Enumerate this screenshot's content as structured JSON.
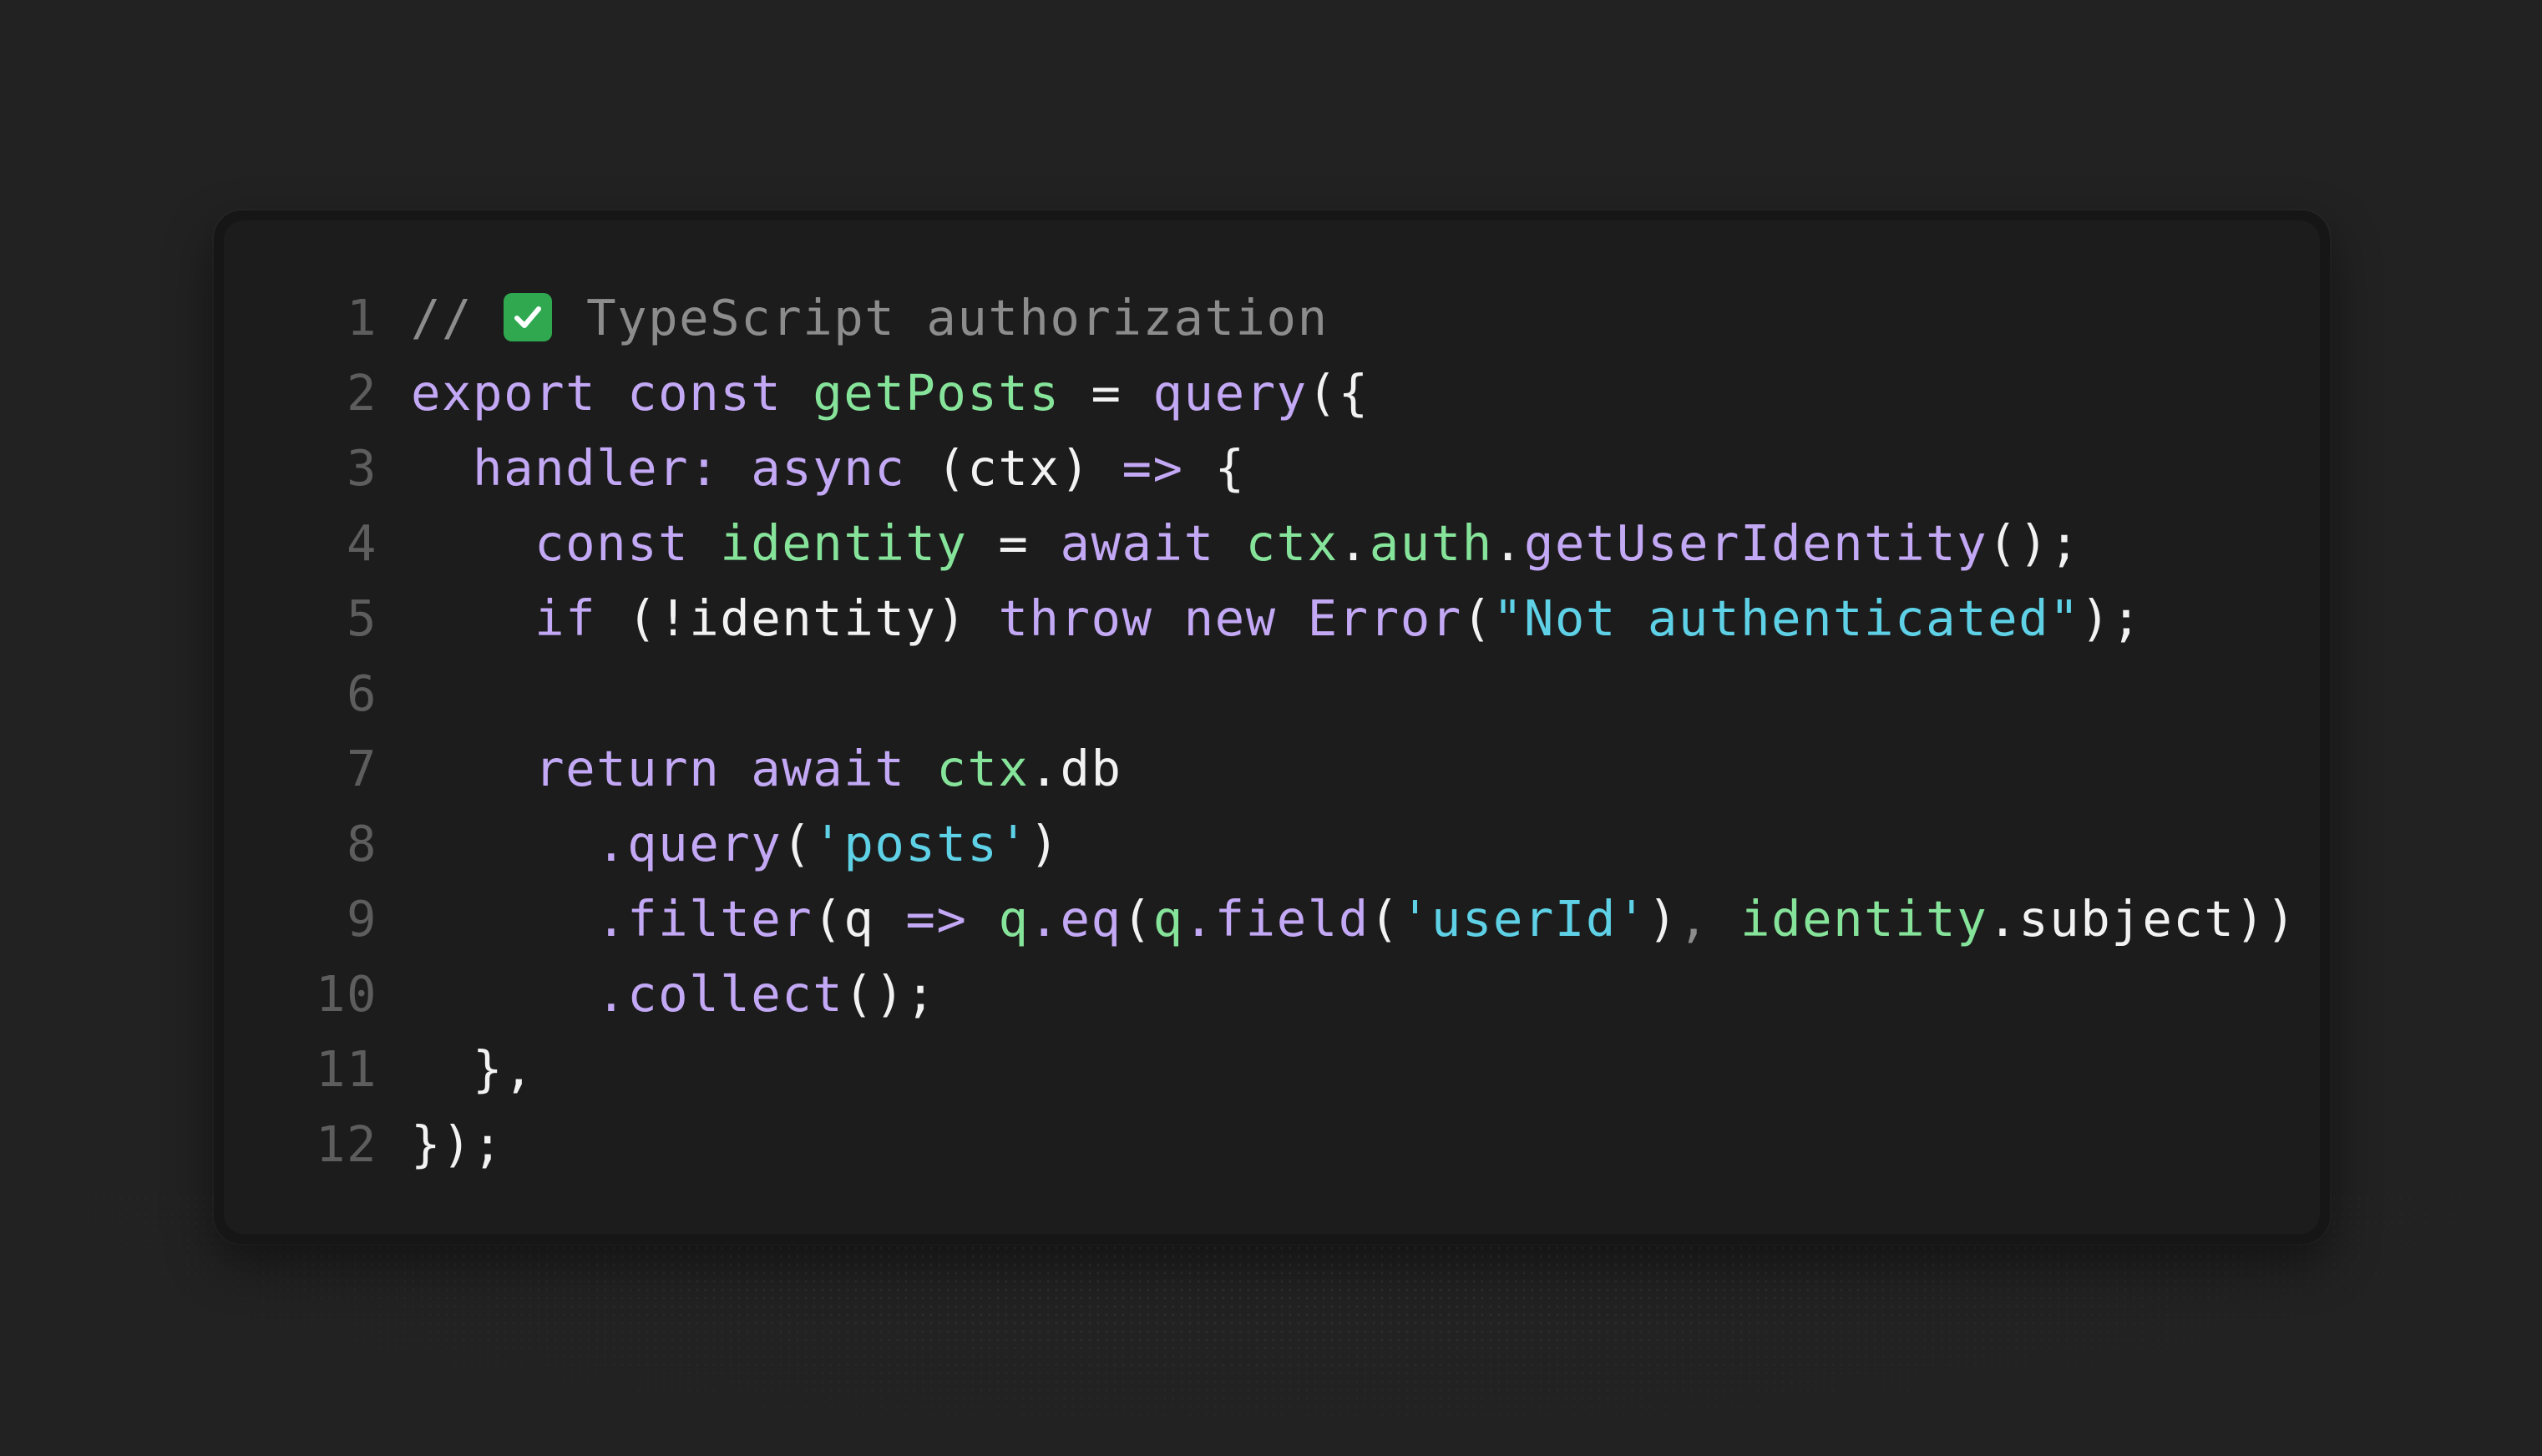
{
  "code_block": {
    "language": "TypeScript",
    "lines": [
      {
        "num": "1",
        "tokens": [
          {
            "t": "// ",
            "c": "comment"
          },
          {
            "icon": "check-mark-icon"
          },
          {
            "t": " TypeScript authorization",
            "c": "comment"
          }
        ]
      },
      {
        "num": "2",
        "tokens": [
          {
            "t": "export const ",
            "c": "kw"
          },
          {
            "t": "getPosts",
            "c": "fn"
          },
          {
            "t": " = ",
            "c": "plain"
          },
          {
            "t": "query",
            "c": "kw"
          },
          {
            "t": "({",
            "c": "plain"
          }
        ]
      },
      {
        "num": "3",
        "tokens": [
          {
            "t": "  ",
            "c": "plain"
          },
          {
            "t": "handler: async ",
            "c": "kw"
          },
          {
            "t": "(ctx) ",
            "c": "plain"
          },
          {
            "t": "=>",
            "c": "kw"
          },
          {
            "t": " {",
            "c": "plain"
          }
        ]
      },
      {
        "num": "4",
        "tokens": [
          {
            "t": "    ",
            "c": "plain"
          },
          {
            "t": "const ",
            "c": "kw"
          },
          {
            "t": "identity",
            "c": "fn"
          },
          {
            "t": " = ",
            "c": "plain"
          },
          {
            "t": "await ",
            "c": "kw"
          },
          {
            "t": "ctx",
            "c": "fn"
          },
          {
            "t": ".",
            "c": "plain"
          },
          {
            "t": "auth",
            "c": "fn"
          },
          {
            "t": ".",
            "c": "plain"
          },
          {
            "t": "getUserIdentity",
            "c": "kw"
          },
          {
            "t": "();",
            "c": "plain"
          }
        ]
      },
      {
        "num": "5",
        "tokens": [
          {
            "t": "    ",
            "c": "plain"
          },
          {
            "t": "if ",
            "c": "kw"
          },
          {
            "t": "(!identity) ",
            "c": "plain"
          },
          {
            "t": "throw new Error",
            "c": "kw"
          },
          {
            "t": "(",
            "c": "plain"
          },
          {
            "t": "\"Not authenticated\"",
            "c": "str"
          },
          {
            "t": ");",
            "c": "plain"
          }
        ]
      },
      {
        "num": "6",
        "tokens": []
      },
      {
        "num": "7",
        "tokens": [
          {
            "t": "    ",
            "c": "plain"
          },
          {
            "t": "return await ",
            "c": "kw"
          },
          {
            "t": "ctx",
            "c": "fn"
          },
          {
            "t": ".db",
            "c": "plain"
          }
        ]
      },
      {
        "num": "8",
        "tokens": [
          {
            "t": "      ",
            "c": "plain"
          },
          {
            "t": ".query",
            "c": "kw"
          },
          {
            "t": "(",
            "c": "plain"
          },
          {
            "t": "'posts'",
            "c": "str"
          },
          {
            "t": ")",
            "c": "plain"
          }
        ]
      },
      {
        "num": "9",
        "tokens": [
          {
            "t": "      ",
            "c": "plain"
          },
          {
            "t": ".filter",
            "c": "kw"
          },
          {
            "t": "(q ",
            "c": "plain"
          },
          {
            "t": "=>",
            "c": "kw"
          },
          {
            "t": " ",
            "c": "plain"
          },
          {
            "t": "q",
            "c": "fn"
          },
          {
            "t": ".",
            "c": "kw"
          },
          {
            "t": "eq",
            "c": "kw"
          },
          {
            "t": "(",
            "c": "plain"
          },
          {
            "t": "q",
            "c": "fn"
          },
          {
            "t": ".",
            "c": "kw"
          },
          {
            "t": "field",
            "c": "kw"
          },
          {
            "t": "(",
            "c": "plain"
          },
          {
            "t": "'userId'",
            "c": "str"
          },
          {
            "t": ")",
            "c": "plain"
          },
          {
            "t": ", ",
            "c": "dim"
          },
          {
            "t": "identity",
            "c": "fn"
          },
          {
            "t": ".subject))",
            "c": "plain"
          }
        ]
      },
      {
        "num": "10",
        "tokens": [
          {
            "t": "      ",
            "c": "plain"
          },
          {
            "t": ".collect",
            "c": "kw"
          },
          {
            "t": "();",
            "c": "plain"
          }
        ]
      },
      {
        "num": "11",
        "tokens": [
          {
            "t": "  },",
            "c": "plain"
          }
        ]
      },
      {
        "num": "12",
        "tokens": [
          {
            "t": "});",
            "c": "plain"
          }
        ]
      }
    ]
  },
  "colors": {
    "background": "#222222",
    "panel": "#1c1c1c",
    "keyword": "#c3a8f5",
    "function": "#86e39a",
    "string": "#5ed1e6",
    "comment": "#8c8c8c",
    "plain": "#f2f2f2",
    "line_number": "#5d5d5d",
    "check_icon": "#2fa84f"
  }
}
